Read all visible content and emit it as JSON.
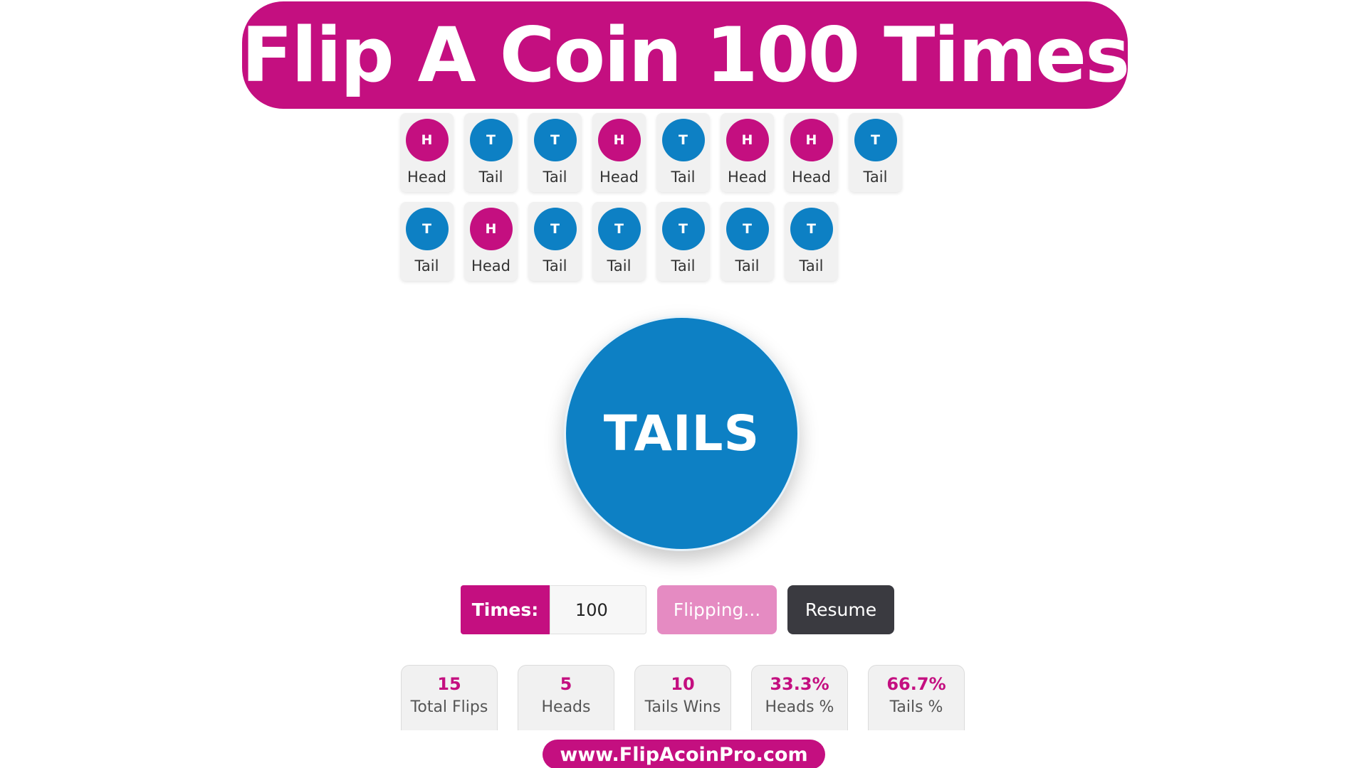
{
  "title": "Flip A Coin 100 Times",
  "history": [
    {
      "symbol": "H",
      "label": "Head",
      "type": "head"
    },
    {
      "symbol": "T",
      "label": "Tail",
      "type": "tail"
    },
    {
      "symbol": "T",
      "label": "Tail",
      "type": "tail"
    },
    {
      "symbol": "H",
      "label": "Head",
      "type": "head"
    },
    {
      "symbol": "T",
      "label": "Tail",
      "type": "tail"
    },
    {
      "symbol": "H",
      "label": "Head",
      "type": "head"
    },
    {
      "symbol": "H",
      "label": "Head",
      "type": "head"
    },
    {
      "symbol": "T",
      "label": "Tail",
      "type": "tail"
    },
    {
      "symbol": "T",
      "label": "Tail",
      "type": "tail"
    },
    {
      "symbol": "H",
      "label": "Head",
      "type": "head"
    },
    {
      "symbol": "T",
      "label": "Tail",
      "type": "tail"
    },
    {
      "symbol": "T",
      "label": "Tail",
      "type": "tail"
    },
    {
      "symbol": "T",
      "label": "Tail",
      "type": "tail"
    },
    {
      "symbol": "T",
      "label": "Tail",
      "type": "tail"
    },
    {
      "symbol": "T",
      "label": "Tail",
      "type": "tail"
    }
  ],
  "coin": {
    "result": "TAILS"
  },
  "controls": {
    "times_label": "Times:",
    "times_value": "100",
    "flipping_label": "Flipping...",
    "resume_label": "Resume"
  },
  "stats": [
    {
      "value": "15",
      "label": "Total Flips"
    },
    {
      "value": "5",
      "label": "Heads"
    },
    {
      "value": "10",
      "label": "Tails Wins"
    },
    {
      "value": "33.3%",
      "label": "Heads %"
    },
    {
      "value": "66.7%",
      "label": "Tails %"
    }
  ],
  "footer": {
    "url": "www.FlipAcoinPro.com"
  },
  "colors": {
    "brand": "#c40f80",
    "head": "#c40f80",
    "tail": "#0d80c4",
    "flipping": "#e58bc2",
    "resume": "#3a3a40"
  }
}
